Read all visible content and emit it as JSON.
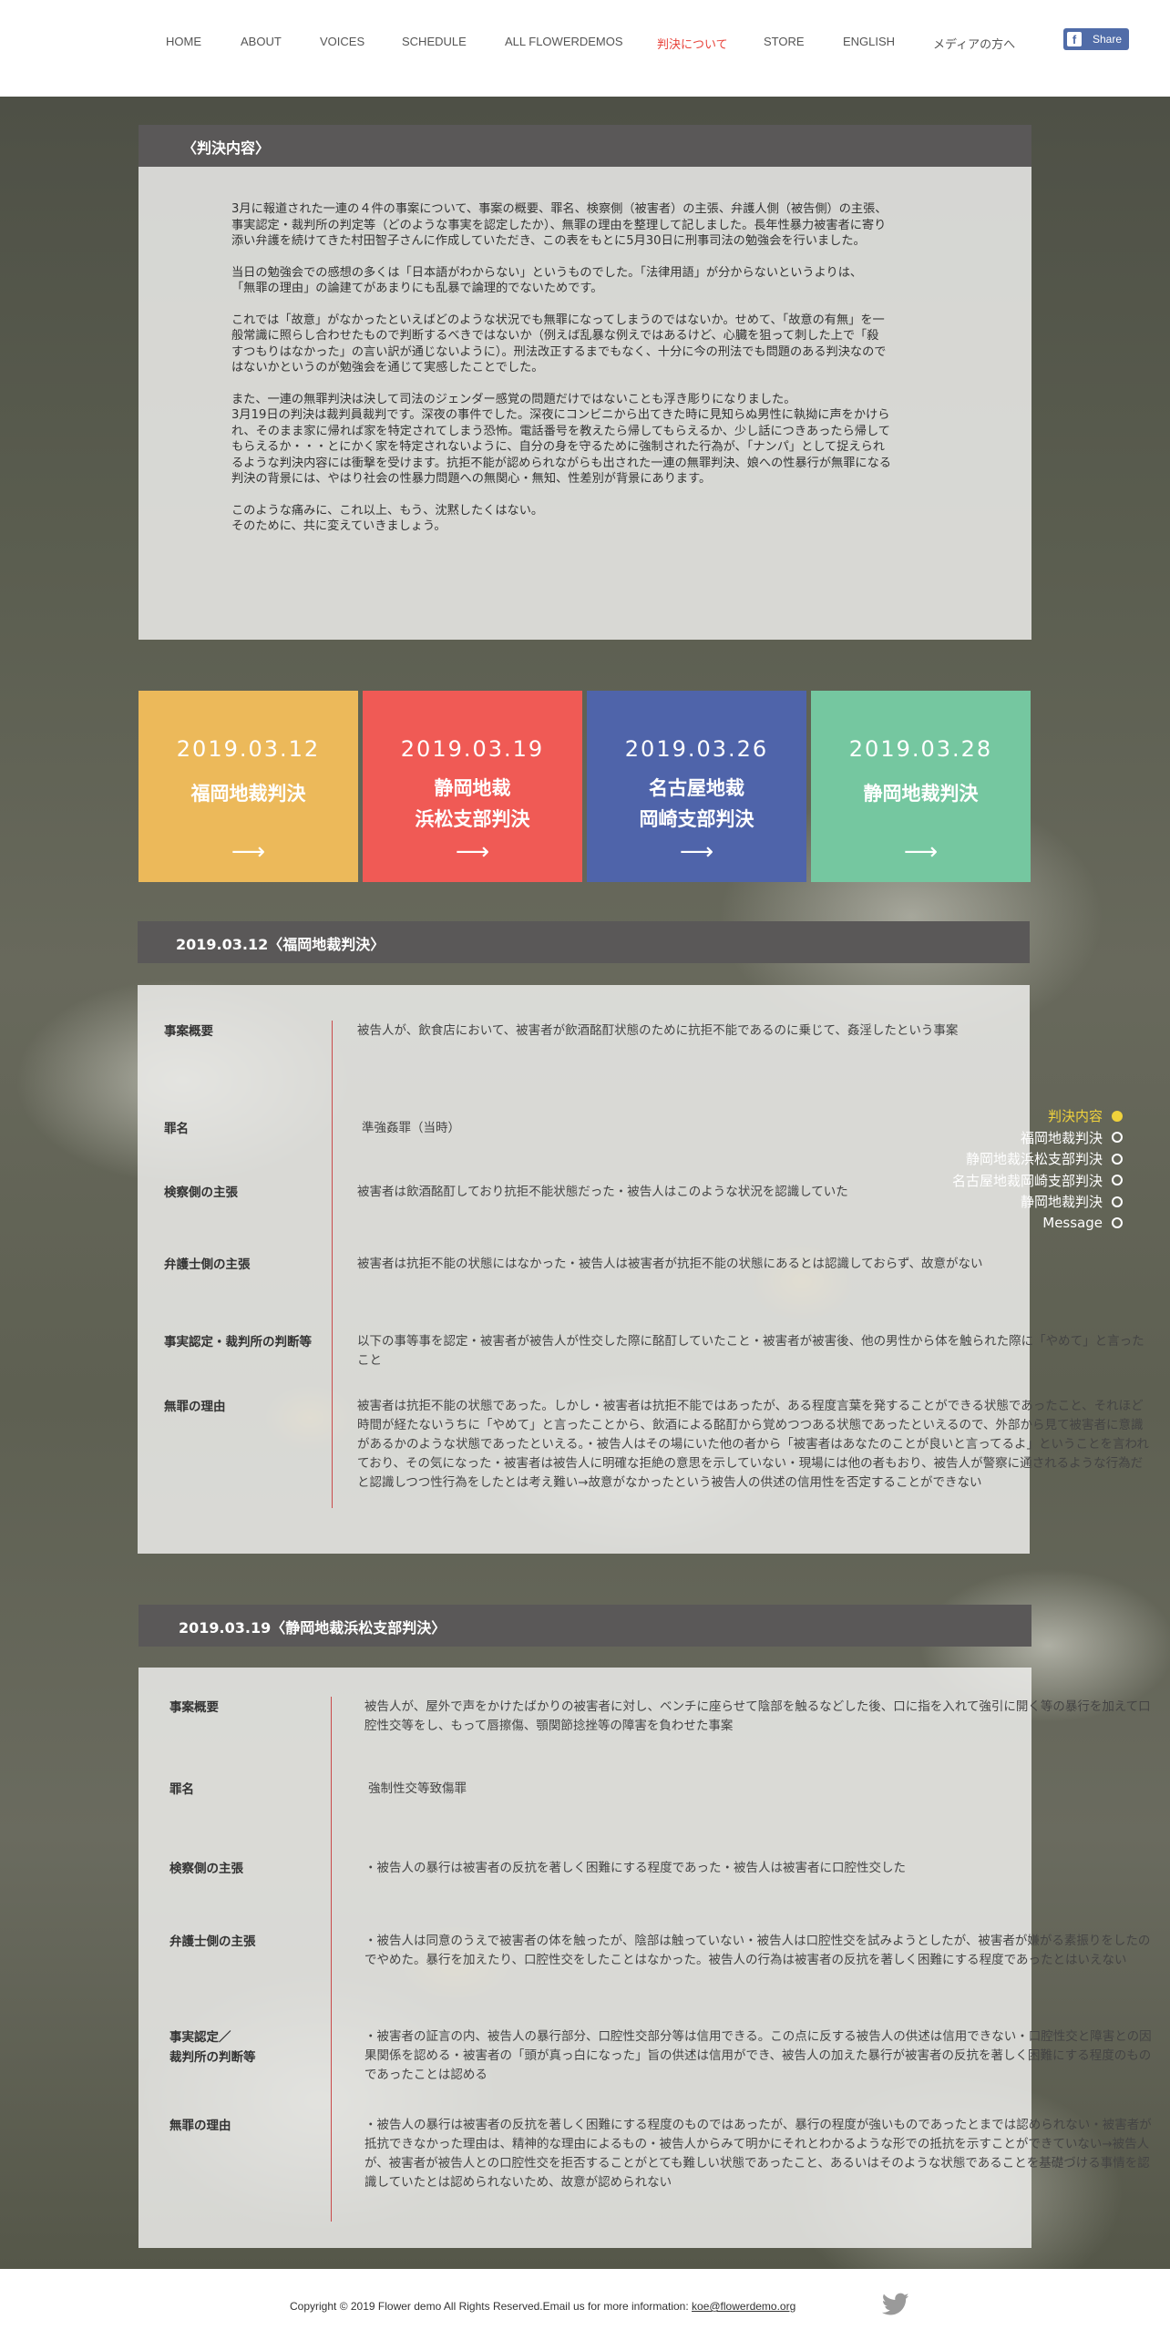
{
  "nav": {
    "items": [
      "HOME",
      "ABOUT",
      "VOICES",
      "SCHEDULE",
      "ALL FLOWERDEMOS",
      "判決について",
      "STORE",
      "ENGLISH",
      "メディアの方へ"
    ],
    "active_index": 5,
    "share_label": "Share"
  },
  "intro": {
    "title": "〈判決内容〉",
    "paragraphs": [
      "3月に報道された一連の４件の事案について、事案の概要、罪名、検察側（被害者）の主張、弁護人側（被告側）の主張、\n事実認定・裁判所の判定等（どのような事実を認定したか）、無罪の理由を整理して記しました。長年性暴力被害者に寄り\n添い弁護を続けてきた村田智子さんに作成していただき、この表をもとに5月30日に刑事司法の勉強会を行いました。",
      "当日の勉強会での感想の多くは「日本語がわからない」というものでした。「法律用語」が分からないというよりは、\n「無罪の理由」の論建てがあまりにも乱暴で論理的でないためです。",
      "これでは「故意」がなかったといえばどのような状況でも無罪になってしまうのではないか。せめて、「故意の有無」を一\n般常識に照らし合わせたもので判断するべきではないか（例えば乱暴な例えではあるけど、心臓を狙って刺した上で「殺\nすつもりはなかった」の言い訳が通じないように）。刑法改正するまでもなく、十分に今の刑法でも問題のある判決なので\nはないかというのが勉強会を通じて実感したことでした。",
      "また、一連の無罪判決は決して司法のジェンダー感覚の問題だけではないことも浮き彫りになりました。\n3月19日の判決は裁判員裁判です。深夜の事件でした。深夜にコンビニから出てきた時に見知らぬ男性に執拗に声をかけら\nれ、そのまま家に帰れば家を特定されてしまう恐怖。電話番号を教えたら帰してもらえるか、少し話につきあったら帰して\nもらえるか・・・とにかく家を特定されないように、自分の身を守るために強制された行為が、「ナンパ」として捉えられ\nるような判決内容には衝撃を受けます。抗拒不能が認められながらも出された一連の無罪判決、娘への性暴行が無罪になる\n判決の背景には、やはり社会の性暴力問題への無関心・無知、性差別が背景にあります。",
      "このような痛みに、これ以上、もう、沈黙したくはない。\nそのために、共に変えていきましょう。"
    ]
  },
  "cards": [
    {
      "date": "2019.03.12",
      "name": "福岡地裁判決",
      "color": "#ecb95a",
      "arrow": "⟶"
    },
    {
      "date": "2019.03.19",
      "name": "静岡地裁\n浜松支部判決",
      "color": "#f05a55",
      "arrow": "⟶"
    },
    {
      "date": "2019.03.26",
      "name": "名古屋地裁\n岡崎支部判決",
      "color": "#4f64aa",
      "arrow": "⟶"
    },
    {
      "date": "2019.03.28",
      "name": "静岡地裁判決",
      "color": "#75c7a0",
      "arrow": "⟶"
    }
  ],
  "side_nav": {
    "items": [
      "判決内容",
      "福岡地裁判決",
      "静岡地裁浜松支部判決",
      "名古屋地裁岡崎支部判決",
      "静岡地裁判決",
      "Message"
    ],
    "active_index": 0
  },
  "fukuoka": {
    "title": "2019.03.12〈福岡地裁判決〉",
    "rows": [
      {
        "label": "事案概要",
        "value": "被告人が、飲食店において、被害者が飲酒酩酊状態のために抗拒不能であるのに乗じて、姦淫したという事案"
      },
      {
        "label": "罪名",
        "value": "準強姦罪（当時）"
      },
      {
        "label": "検察側の主張",
        "value": "被害者は飲酒酩酊しており抗拒不能状態だった・被告人はこのような状況を認識していた"
      },
      {
        "label": "弁護士側の主張",
        "value": "被害者は抗拒不能の状態にはなかった・被告人は被害者が抗拒不能の状態にあるとは認識しておらず、故意がない"
      },
      {
        "label": "事実認定・裁判所の判断等",
        "value": "以下の事等事を認定・被害者が被告人が性交した際に酩酊していたこと・被害者が被害後、他の男性から体を触られた際に「やめて」と言ったこと"
      },
      {
        "label": "無罪の理由",
        "value": "被害者は抗拒不能の状態であった。しかし・被害者は抗拒不能ではあったが、ある程度言葉を発することができる状態であったこと、それほど時間が経たないうちに「やめて」と言ったことから、飲酒による酩酊から覚めつつある状態であったといえるので、外部から見て被害者に意識があるかのような状態であったといえる。・被告人はその場にいた他の者から「被害者はあなたのことが良いと言ってるよ」ということを言われており、その気になった・被害者は被告人に明確な拒絶の意思を示していない・現場には他の者もおり、被告人が警察に通されるような行為だと認識しつつ性行為をしたとは考え難い→故意がなかったという被告人の供述の信用性を否定することができない"
      }
    ]
  },
  "hamamatsu": {
    "title": "2019.03.19〈静岡地裁浜松支部判決〉",
    "rows": [
      {
        "label": "事案概要",
        "value": "被告人が、屋外で声をかけたばかりの被害者に対し、ベンチに座らせて陰部を触るなどした後、口に指を入れて強引に開く等の暴行を加えて口腔性交等をし、もって唇擦傷、顎関節捻挫等の障害を負わせた事案"
      },
      {
        "label": "罪名",
        "value": "強制性交等致傷罪"
      },
      {
        "label": "検察側の主張",
        "value": "・被告人の暴行は被害者の反抗を著しく困難にする程度であった・被告人は被害者に口腔性交した"
      },
      {
        "label": "弁護士側の主張",
        "value": "・被告人は同意のうえで被害者の体を触ったが、陰部は触っていない・被告人は口腔性交を試みようとしたが、被害者が嫌がる素振りをしたのでやめた。暴行を加えたり、口腔性交をしたことはなかった。被告人の行為は被害者の反抗を著しく困難にする程度であったとはいえない"
      },
      {
        "label": "事実認定／\n裁判所の判断等",
        "value": "・被害者の証言の内、被告人の暴行部分、口腔性交部分等は信用できる。この点に反する被告人の供述は信用できない・口腔性交と障害との因果関係を認める・被害者の「頭が真っ白になった」旨の供述は信用ができ、被告人の加えた暴行が被害者の反抗を著しく困難にする程度のものであったことは認める"
      },
      {
        "label": "無罪の理由",
        "value": "・被告人の暴行は被害者の反抗を著しく困難にする程度のものではあったが、暴行の程度が強いものであったとまでは認められない・被害者が抵抗できなかった理由は、精神的な理由によるもの・被告人からみて明かにそれとわかるような形での抵抗を示すことができていない→被告人が、被害者が被告人との口腔性交を拒否することがとても難しい状態であったこと、あるいはそのような状態であることを基礎づける事情を認識していたとは認められないため、故意が認められない"
      }
    ]
  },
  "footer": {
    "copyright": "Copyright © 2019 Flower demo All Rights Reserved.Email us for more information: ",
    "email": "koe@flowerdemo.org"
  }
}
